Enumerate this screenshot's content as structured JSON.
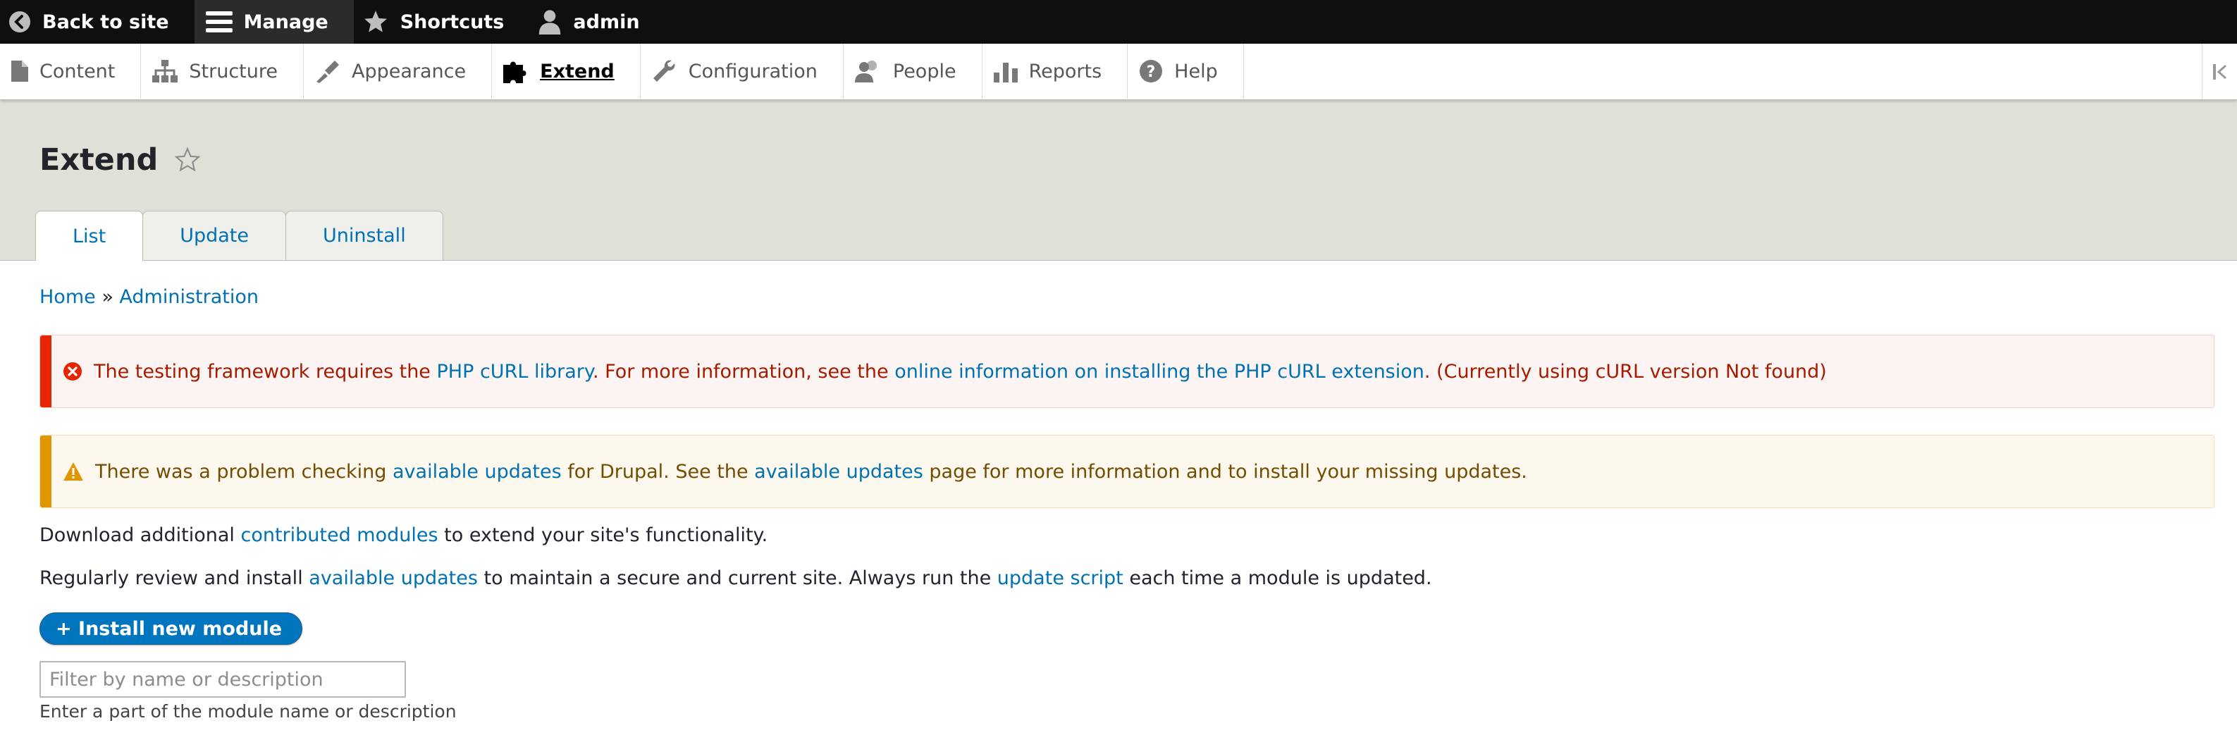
{
  "toolbar": {
    "back_to_site": "Back to site",
    "manage": "Manage",
    "shortcuts": "Shortcuts",
    "user": "admin"
  },
  "tray": {
    "items": [
      {
        "label": "Content",
        "icon": "file-icon"
      },
      {
        "label": "Structure",
        "icon": "sitemap-icon"
      },
      {
        "label": "Appearance",
        "icon": "paintbrush-icon"
      },
      {
        "label": "Extend",
        "icon": "puzzle-icon",
        "active": true
      },
      {
        "label": "Configuration",
        "icon": "wrench-icon"
      },
      {
        "label": "People",
        "icon": "people-icon"
      },
      {
        "label": "Reports",
        "icon": "bar-chart-icon"
      },
      {
        "label": "Help",
        "icon": "help-icon"
      }
    ]
  },
  "page": {
    "title": "Extend",
    "tabs": [
      {
        "label": "List",
        "active": true
      },
      {
        "label": "Update"
      },
      {
        "label": "Uninstall"
      }
    ]
  },
  "breadcrumb": {
    "home": "Home",
    "separator": " » ",
    "administration": "Administration"
  },
  "error_message": {
    "part1": "The testing framework requires the ",
    "link1": "PHP cURL library",
    "part2": ". For more information, see the ",
    "link2": "online information on installing the PHP cURL extension",
    "part3": ". (Currently using cURL version Not found)"
  },
  "warning_message": {
    "part1": "There was a problem checking ",
    "link1": "available updates",
    "part2": " for Drupal. See the ",
    "link2": "available updates",
    "part3": " page for more information and to install your missing updates."
  },
  "intro1": {
    "part1": "Download additional ",
    "link": "contributed modules",
    "part2": " to extend your site's functionality."
  },
  "intro2": {
    "part1": "Regularly review and install ",
    "link1": "available updates",
    "part2": " to maintain a secure and current site. Always run the ",
    "link2": "update script",
    "part3": " each time a module is updated."
  },
  "install_button": "+ Install new module",
  "filter": {
    "placeholder": "Filter by name or description",
    "description": "Enter a part of the module name or description"
  },
  "colors": {
    "toolbar_bg": "#0f0f0f",
    "link": "#0071b3",
    "error_accent": "#e62600",
    "warning_accent": "#e09600",
    "button": "#0074bd"
  }
}
